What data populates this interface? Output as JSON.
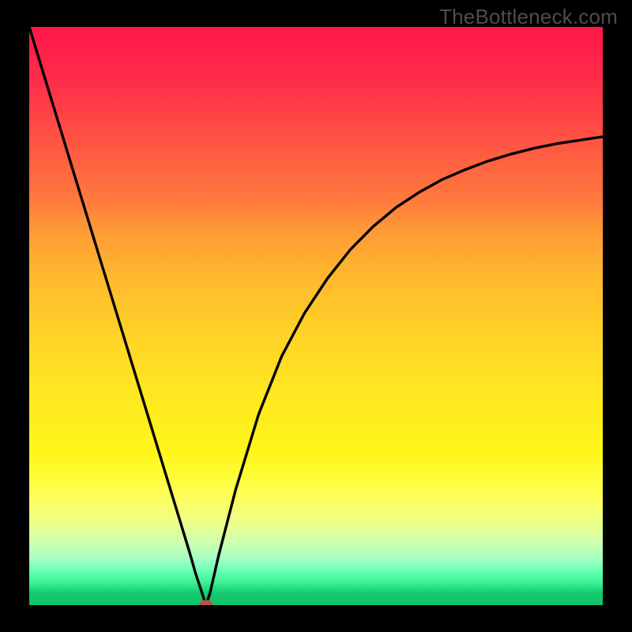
{
  "watermark": "TheBottleneck.com",
  "chart_data": {
    "type": "line",
    "title": "",
    "xlabel": "",
    "ylabel": "",
    "xlim": [
      0,
      100
    ],
    "ylim": [
      0,
      100
    ],
    "grid": false,
    "legend": false,
    "colors": {
      "top": "#ff1547",
      "mid_upper": "#ffb030",
      "mid": "#fff61a",
      "mid_lower": "#c8ffb0",
      "bottom": "#11c16b",
      "curve": "#000000",
      "marker": "#be4f4a",
      "frame": "#000000"
    },
    "series": [
      {
        "name": "bottleneck-curve",
        "x": [
          0,
          2,
          4,
          6,
          8,
          10,
          12,
          14,
          16,
          18,
          20,
          22,
          24,
          26,
          28,
          29,
          30,
          30.8,
          31.5,
          33,
          36,
          40,
          44,
          48,
          52,
          56,
          60,
          64,
          68,
          72,
          76,
          80,
          84,
          88,
          92,
          96,
          100
        ],
        "y": [
          100,
          93.5,
          87,
          80.5,
          74,
          67.5,
          61,
          54.5,
          48,
          41.5,
          35,
          28.5,
          22,
          15.5,
          9,
          5.5,
          2.5,
          0,
          2,
          8.5,
          20,
          33,
          43,
          50.5,
          56.5,
          61.5,
          65.5,
          68.8,
          71.4,
          73.6,
          75.3,
          76.8,
          78.0,
          79.0,
          79.8,
          80.4,
          81.0
        ]
      }
    ],
    "markers": [
      {
        "name": "minimum",
        "x": 30.8,
        "y": 0,
        "color": "#be4f4a",
        "shape": "ellipse",
        "rx": 1.2,
        "ry": 0.9
      }
    ]
  }
}
